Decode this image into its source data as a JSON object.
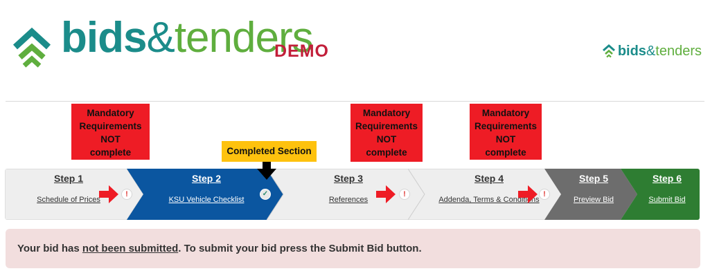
{
  "header": {
    "logo_bids": "bids",
    "logo_amp": "&",
    "logo_tenders": "tenders",
    "demo_label": "DEMO",
    "brand_teal": "#1b8c8a",
    "brand_green": "#5fae3e",
    "demo_red": "#c21f3a"
  },
  "callouts": {
    "mandatory_line1": "Mandatory",
    "mandatory_line2": "Requirements",
    "mandatory_line3": "NOT",
    "mandatory_line4": "complete",
    "completed_section": "Completed Section",
    "red_color": "#ee1c25",
    "yellow_color": "#fec20e"
  },
  "steps": [
    {
      "title": "Step 1",
      "label": "Schedule of Prices",
      "status": "warning",
      "status_icon": "!"
    },
    {
      "title": "Step 2",
      "label": "KSU Vehicle Checklist",
      "status": "complete",
      "status_icon": "✓"
    },
    {
      "title": "Step 3",
      "label": "References",
      "status": "warning",
      "status_icon": "!"
    },
    {
      "title": "Step 4",
      "label": "Addenda, Terms & Conditions",
      "status": "warning",
      "status_icon": "!"
    },
    {
      "title": "Step 5",
      "label": "Preview Bid"
    },
    {
      "title": "Step 6",
      "label": "Submit Bid"
    }
  ],
  "step_colors": {
    "inactive": "#eeeeee",
    "active": "#0b56a0",
    "preview": "#6d6d6d",
    "submit": "#2e7d32"
  },
  "notice": {
    "before": "Your bid has ",
    "emphasis": "not been submitted",
    "after": ". To submit your bid press the Submit Bid button."
  }
}
